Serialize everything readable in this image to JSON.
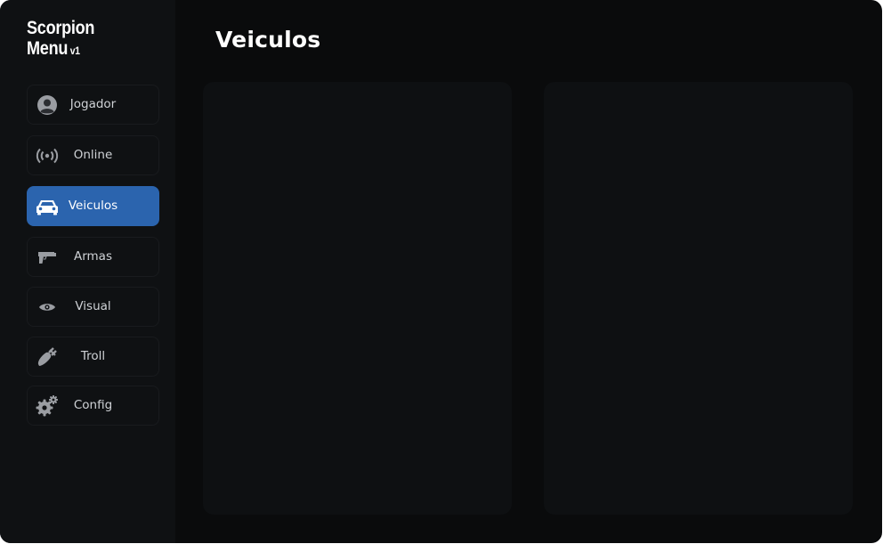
{
  "app": {
    "logo_line1": "Scorpion",
    "logo_line2": "Menu",
    "version": "v1"
  },
  "page": {
    "title": "Veiculos"
  },
  "sidebar": {
    "items": [
      {
        "label": "Jogador",
        "icon": "user-icon",
        "active": false
      },
      {
        "label": "Online",
        "icon": "broadcast-icon",
        "active": false
      },
      {
        "label": "Veiculos",
        "icon": "car-icon",
        "active": true
      },
      {
        "label": "Armas",
        "icon": "pistol-icon",
        "active": false
      },
      {
        "label": "Visual",
        "icon": "eye-icon",
        "active": false
      },
      {
        "label": "Troll",
        "icon": "bomb-icon",
        "active": false
      },
      {
        "label": "Config",
        "icon": "gears-icon",
        "active": false
      }
    ]
  },
  "colors": {
    "background": "#0a0b0c",
    "sidebar": "#0f1113",
    "accent": "#2b64ae",
    "panel": "#0e1012",
    "text": "#cfd2d6"
  }
}
